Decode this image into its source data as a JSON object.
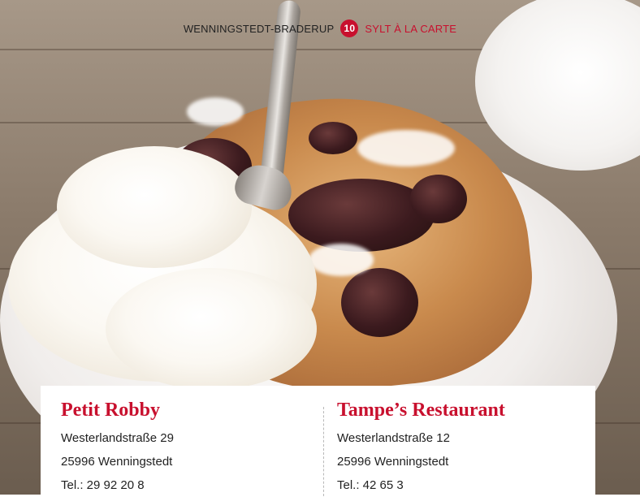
{
  "header": {
    "location": "WENNINGSTEDT-BRADERUP",
    "page_number": "10",
    "section": "SYLT À LA CARTE"
  },
  "restaurants": [
    {
      "name": "Petit Robby",
      "street": "Westerlandstraße 29",
      "city": "25996 Wenningstedt",
      "phone": "Tel.: 29 92 20 8"
    },
    {
      "name": "Tampe’s Restaurant",
      "street": "Westerlandstraße 12",
      "city": "25996 Wenningstedt",
      "phone": "Tel.: 42 65 3"
    }
  ],
  "colors": {
    "accent": "#c8102e",
    "text": "#222222",
    "panel": "#ffffff"
  }
}
